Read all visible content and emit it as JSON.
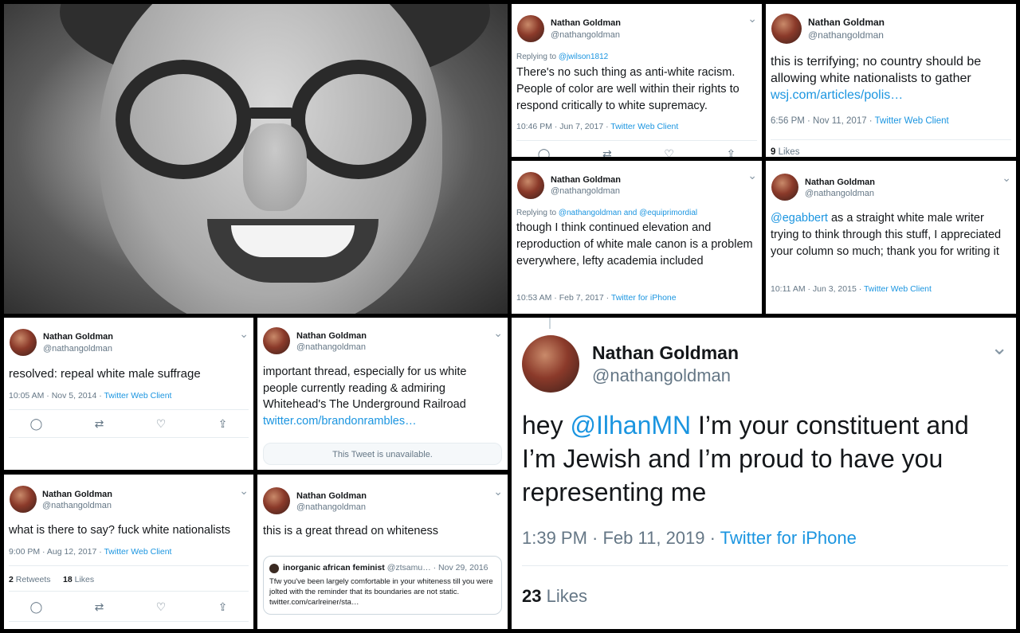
{
  "profile": {
    "name": "Nathan Goldman",
    "handle": "@nathangoldman"
  },
  "tweets": {
    "t1": {
      "reply_prefix": "Replying to ",
      "reply_to": "@jwilson1812",
      "text": "There's no such thing as anti-white racism. People of color are well within their rights to respond critically to white supremacy.",
      "time": "10:46 PM · Jun 7, 2017 · ",
      "source": "Twitter Web Client"
    },
    "t2": {
      "text": "this is terrifying; no country should be allowing white nationalists to gather ",
      "link": "wsj.com/articles/polis…",
      "time": "6:56 PM · Nov 11, 2017 · ",
      "source": "Twitter Web Client",
      "likes_count": "9",
      "likes_label": " Likes"
    },
    "t3": {
      "reply_prefix": "Replying to ",
      "reply_to": "@nathangoldman and @equiprimordial",
      "text": "though I think continued elevation and reproduction of white male canon is a problem everywhere, lefty academia included",
      "time": "10:53 AM · Feb 7, 2017 · ",
      "source": "Twitter for iPhone"
    },
    "t4": {
      "mention": "@egabbert",
      "text": " as a straight white male writer trying to think through this stuff, I appreciated your column so much; thank you for writing it",
      "time": "10:11 AM · Jun 3, 2015 · ",
      "source": "Twitter Web Client"
    },
    "t5": {
      "text": "resolved: repeal white male suffrage",
      "time": "10:05 AM · Nov 5, 2014 · ",
      "source": "Twitter Web Client"
    },
    "t6": {
      "text": "important thread, especially for us white people currently reading & admiring Whitehead's The Underground Railroad ",
      "link": "twitter.com/brandonrambles…",
      "unavailable": "This Tweet is unavailable."
    },
    "t7": {
      "prefix": "hey ",
      "mention": "@IlhanMN",
      "text": " I’m your constituent and I’m Jewish and I’m proud to have you representing me",
      "time": "1:39 PM · Feb 11, 2019 · ",
      "source": "Twitter for iPhone",
      "likes_count": "23",
      "likes_label": " Likes"
    },
    "t8": {
      "text": "what is there to say? fuck white nationalists",
      "time": "9:00 PM · Aug 12, 2017 · ",
      "source": "Twitter Web Client",
      "retweets_count": "2",
      "retweets_label": " Retweets",
      "likes_count": "18",
      "likes_label": " Likes"
    },
    "t9": {
      "text": "this is a great thread on whiteness",
      "quote_name": "inorganic african feminist",
      "quote_handle": " @ztsamu…",
      "quote_date": " · Nov 29, 2016",
      "quote_text": "Tfw you've been largely comfortable in your whiteness till you were jolted with the reminder that its boundaries are not static. twitter.com/carlreiner/sta…"
    }
  },
  "icons": {
    "chevron": "⌄",
    "reply": "◯",
    "retweet": "⇄",
    "like": "♡",
    "share": "⇪"
  },
  "colors": {
    "link": "#1b95e0",
    "muted": "#657786",
    "text": "#14171a"
  }
}
